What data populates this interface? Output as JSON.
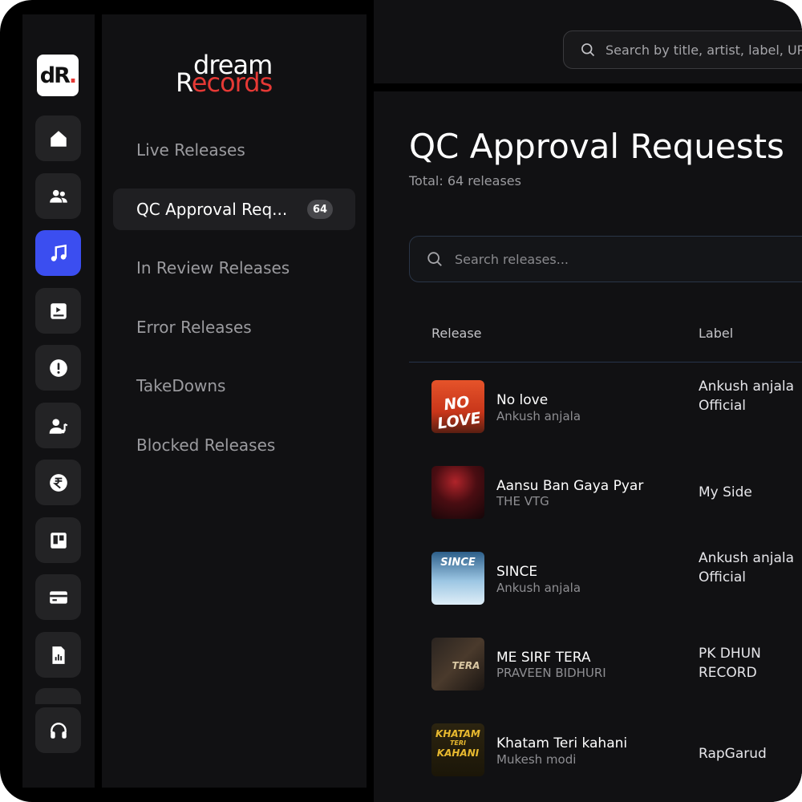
{
  "rail": {
    "logo_text_d": "d",
    "logo_text_r": "R",
    "logo_text_dot": ".",
    "items": [
      {
        "icon": "home-icon"
      },
      {
        "icon": "users-icon"
      },
      {
        "icon": "music-icon",
        "active": true
      },
      {
        "icon": "video-icon"
      },
      {
        "icon": "alert-icon"
      },
      {
        "icon": "artist-icon"
      },
      {
        "icon": "rupee-icon"
      },
      {
        "icon": "board-icon"
      },
      {
        "icon": "card-icon"
      },
      {
        "icon": "report-icon"
      },
      {
        "icon": "headphones-icon"
      }
    ]
  },
  "brand": {
    "line1": "dream",
    "line2_a": "R",
    "line2_b": "ecords"
  },
  "subnav": {
    "items": [
      {
        "label": "Live Releases"
      },
      {
        "label": "QC Approval Req...",
        "badge": "64",
        "active": true
      },
      {
        "label": "In Review Releases"
      },
      {
        "label": "Error Releases"
      },
      {
        "label": "TakeDowns"
      },
      {
        "label": "Blocked Releases"
      }
    ]
  },
  "topbar": {
    "search_placeholder": "Search by title, artist, label, UPC"
  },
  "main": {
    "title": "QC Approval Requests",
    "subtitle": "Total: 64 releases",
    "search_placeholder": "Search releases...",
    "columns": [
      "Release",
      "Label"
    ],
    "rows": [
      {
        "title": "No love",
        "artist": "Ankush anjala",
        "label": "Ankush anjala Official",
        "cover_text": "NO LOVE"
      },
      {
        "title": "Aansu Ban Gaya Pyar",
        "artist": "THE VTG",
        "label": "My Side",
        "cover_text": ""
      },
      {
        "title": "SINCE",
        "artist": "Ankush anjala",
        "label": "Ankush anjala Official",
        "cover_text": "SINCE"
      },
      {
        "title": "ME SIRF TERA",
        "artist": "PRAVEEN BIDHURI",
        "label": "PK DHUN RECORD",
        "cover_text": "TERA"
      },
      {
        "title": "Khatam Teri kahani",
        "artist": "Mukesh modi",
        "label": "RapGarud",
        "cover_text_1": "KHATAM",
        "cover_text_2": "TERI",
        "cover_text_3": "KAHANI"
      }
    ]
  },
  "colors": {
    "accent": "#3b4ef0",
    "brand_red": "#e53935",
    "panel": "#111113",
    "tile": "#232325"
  }
}
